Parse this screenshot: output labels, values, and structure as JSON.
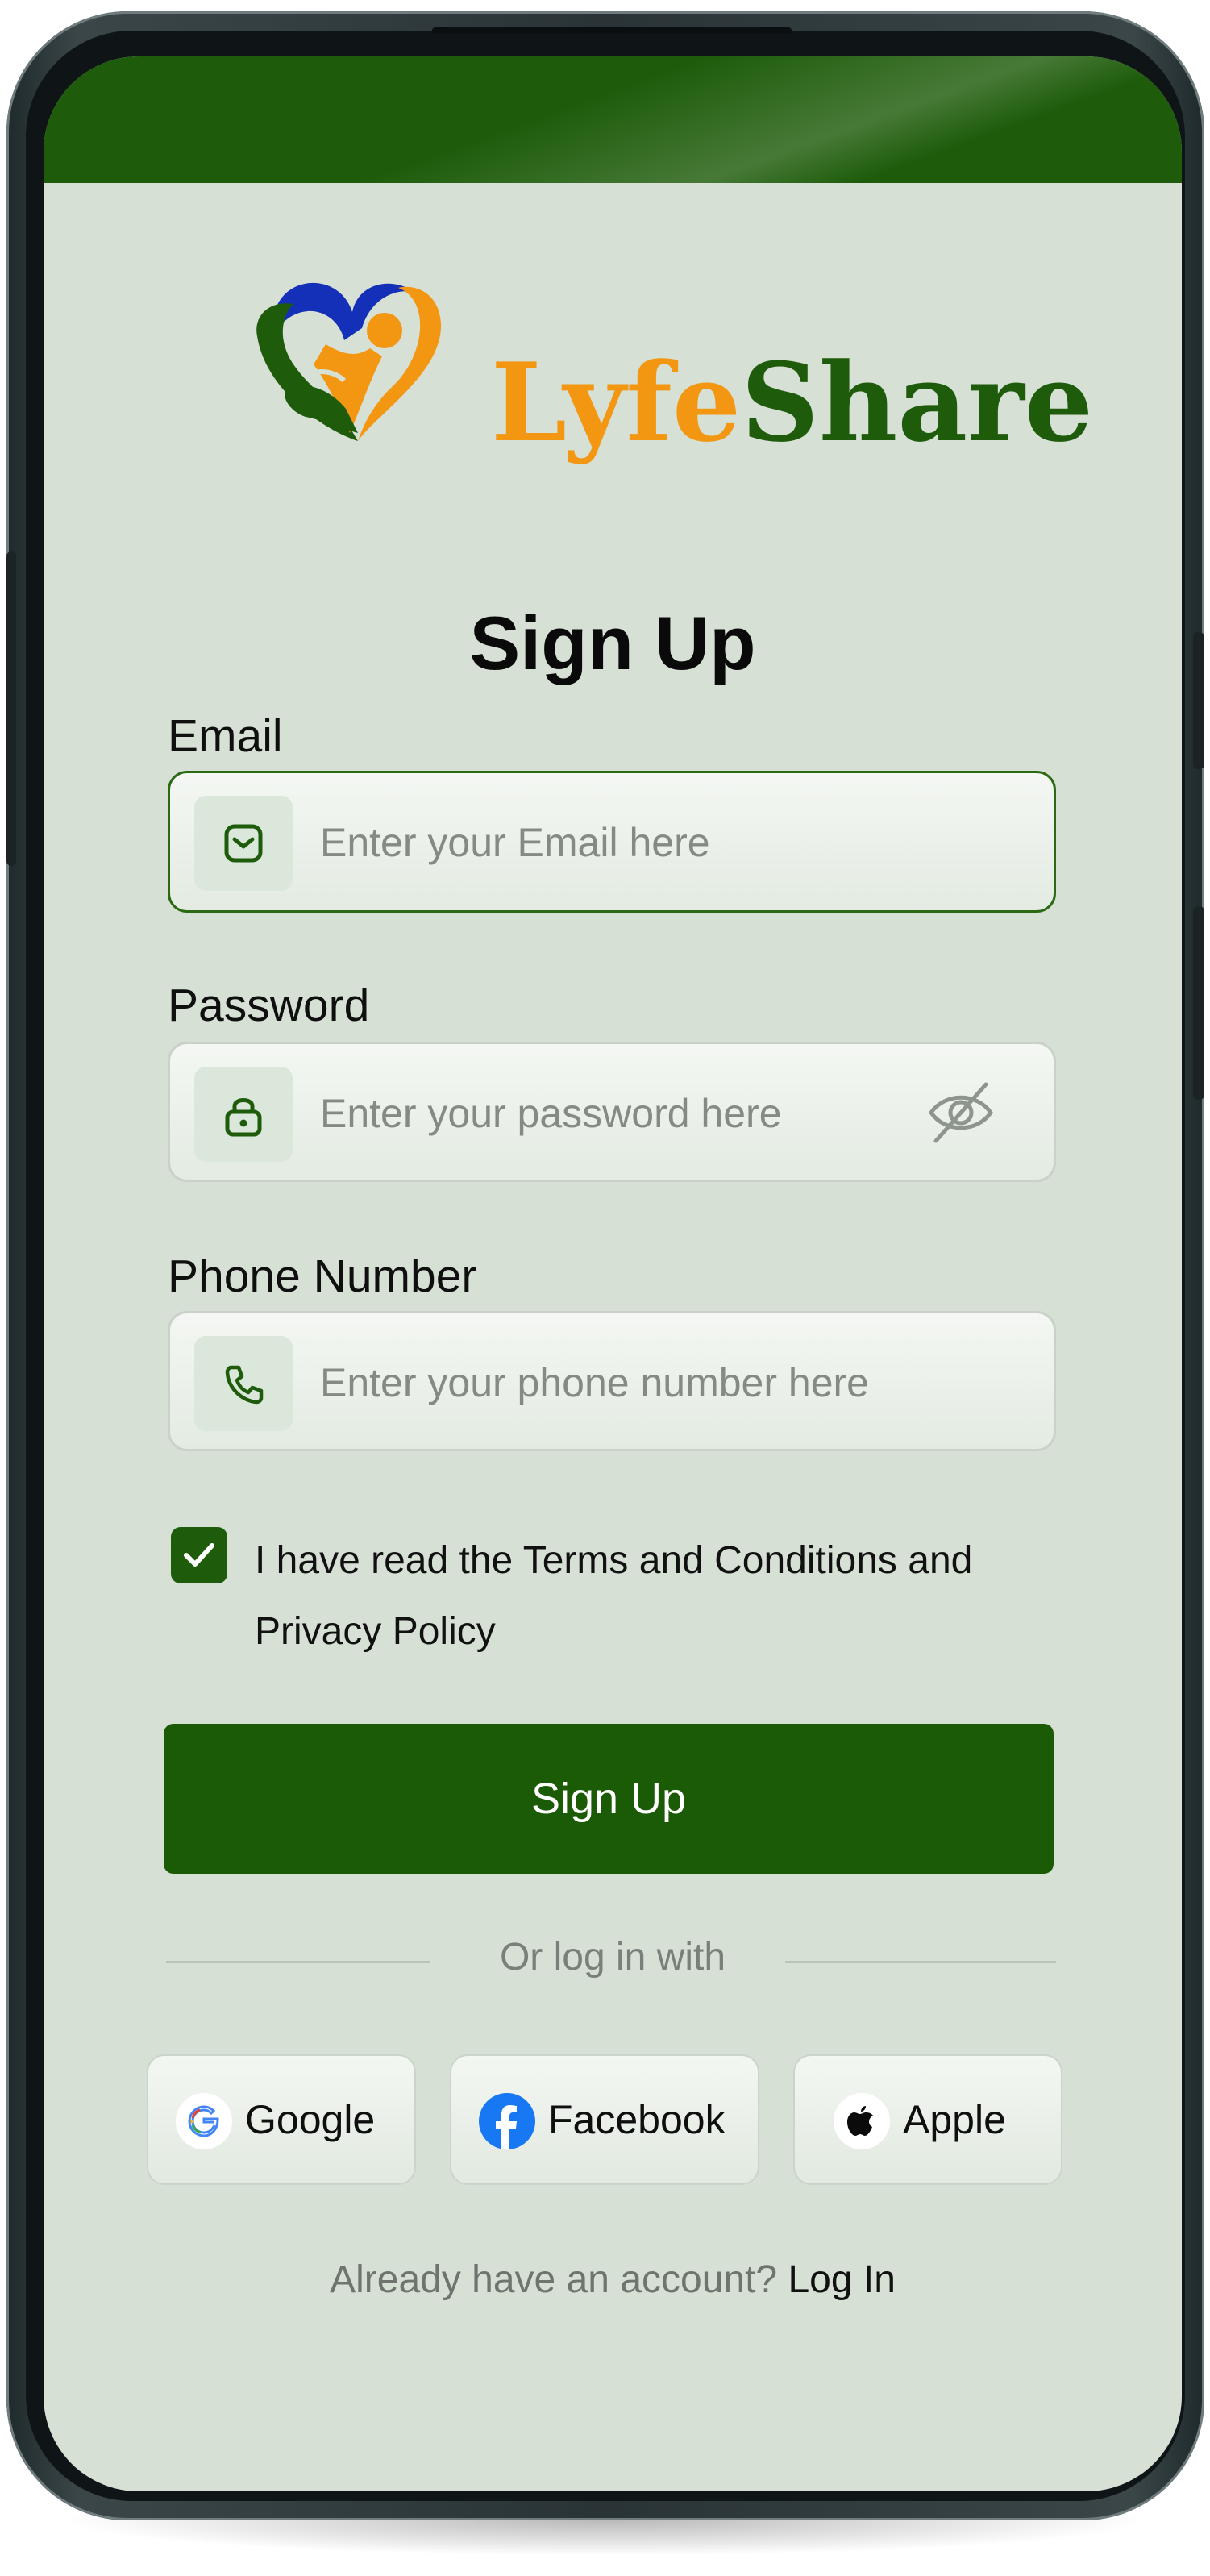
{
  "app": {
    "brand_part1": "Lyfe",
    "brand_part2": "Share"
  },
  "page": {
    "title": "Sign Up"
  },
  "form": {
    "email": {
      "label": "Email",
      "placeholder": "Enter your Email here",
      "icon": "envelope-icon"
    },
    "password": {
      "label": "Password",
      "placeholder": "Enter your password here",
      "icon": "lock-icon",
      "toggle_icon": "eye-off-icon"
    },
    "phone": {
      "label": "Phone Number",
      "placeholder": "Enter your phone number here",
      "icon": "phone-icon"
    },
    "terms": {
      "checked": true,
      "text": "I have read the Terms and Conditions and Privacy Policy"
    },
    "submit_label": "Sign Up"
  },
  "social": {
    "divider_text": "Or log in with",
    "buttons": [
      {
        "label": "Google",
        "icon": "google-icon"
      },
      {
        "label": "Facebook",
        "icon": "facebook-icon"
      },
      {
        "label": "Apple",
        "icon": "apple-icon"
      }
    ]
  },
  "footer": {
    "prompt": "Already have an account?",
    "link": "Log In"
  },
  "colors": {
    "primary": "#1b5b06",
    "brand_orange": "#f39712",
    "background": "#d6e0d5"
  }
}
